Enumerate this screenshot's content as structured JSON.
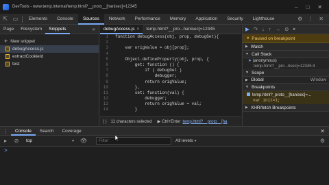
{
  "window": {
    "title": "DevTools - www.temp.internal/temp.html?__proto__[hanisec]=12345"
  },
  "main_tabs": [
    "Elements",
    "Console",
    "Sources",
    "Network",
    "Performance",
    "Memory",
    "Application",
    "Security",
    "Lighthouse"
  ],
  "active_main_tab": "Sources",
  "left_panel": {
    "tabs": [
      "Page",
      "Filesystem",
      "Snippets"
    ],
    "new_snippet_label": "New snippet",
    "snippets": [
      "debugAccess.js",
      "extractCookieId",
      "test"
    ]
  },
  "editor": {
    "tabs": [
      "debugAccess.js",
      "temp.html?__pro...hanisec]=12345"
    ],
    "lines": [
      {
        "n": "1",
        "text": "function debugAccess(obj, prop, debugGet){"
      },
      {
        "n": "2",
        "text": ""
      },
      {
        "n": "3",
        "text": "    var origValue = obj[prop];"
      },
      {
        "n": "4",
        "text": ""
      },
      {
        "n": "5",
        "text": "    Object.defineProperty(obj, prop, {"
      },
      {
        "n": "6",
        "text": "        get: function () {"
      },
      {
        "n": "7",
        "text": "            if ( debugGet )"
      },
      {
        "n": "8",
        "text": "                debugger;"
      },
      {
        "n": "9",
        "text": "            return origValue;"
      },
      {
        "n": "10",
        "text": "        },"
      },
      {
        "n": "11",
        "text": "        set: function(val) {"
      },
      {
        "n": "12",
        "text": "            debugger;"
      },
      {
        "n": "13",
        "text": "            return origValue = val;"
      },
      {
        "n": "14",
        "text": "        }"
      }
    ],
    "status": {
      "selection": "11 characters selected",
      "run_hint": "Ctrl+Enter",
      "source_link": "temp.html?__proto__[ha"
    }
  },
  "debugger": {
    "paused_text": "Paused on breakpoint",
    "watch_label": "Watch",
    "call_stack_label": "Call Stack",
    "frame_name": "(anonymous)",
    "frame_location": "temp.html?__pro...risec]=12345:4",
    "scope_label": "Scope",
    "global_label": "Global",
    "global_value": "Window",
    "breakpoints_label": "Breakpoints",
    "breakpoint_file": "temp.html?_proto__[hanisec]=...",
    "breakpoint_code": "var init=1;",
    "xhr_label": "XHR/fetch Breakpoints"
  },
  "drawer": {
    "tabs": [
      "Console",
      "Search",
      "Coverage"
    ],
    "context": "top",
    "filter_placeholder": "Filter",
    "levels": "All levels",
    "prompt_symbol": ">"
  }
}
